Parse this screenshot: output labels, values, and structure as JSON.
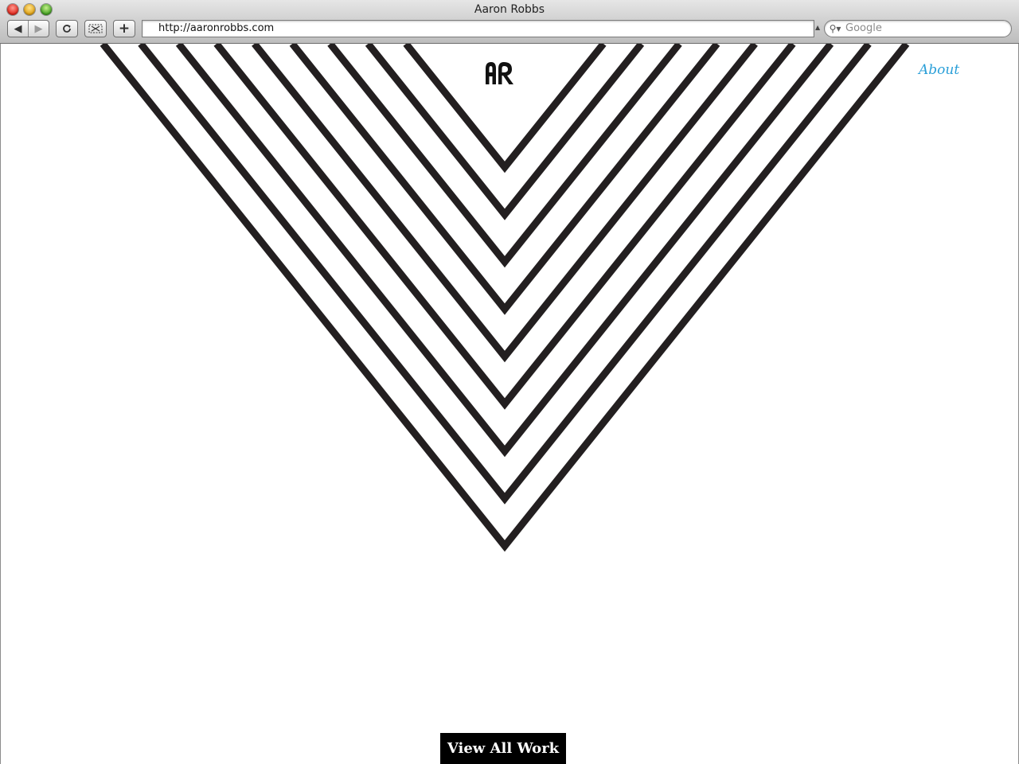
{
  "window": {
    "title": "Aaron Robbs"
  },
  "toolbar": {
    "back_icon": "back-arrow-icon",
    "forward_icon": "forward-arrow-icon",
    "reload_icon": "reload-icon",
    "snip_icon": "snip-icon",
    "add_label": "+"
  },
  "address_bar": {
    "url": "http://aaronrobbs.com"
  },
  "search_bar": {
    "placeholder": "Google"
  },
  "page": {
    "logo_alt": "AR",
    "nav": {
      "about_label": "About"
    },
    "cta": {
      "view_all_label": "View All Work"
    },
    "colors": {
      "stripe": "#231f20",
      "link": "#2a9fd8",
      "button_bg": "#000000"
    }
  }
}
